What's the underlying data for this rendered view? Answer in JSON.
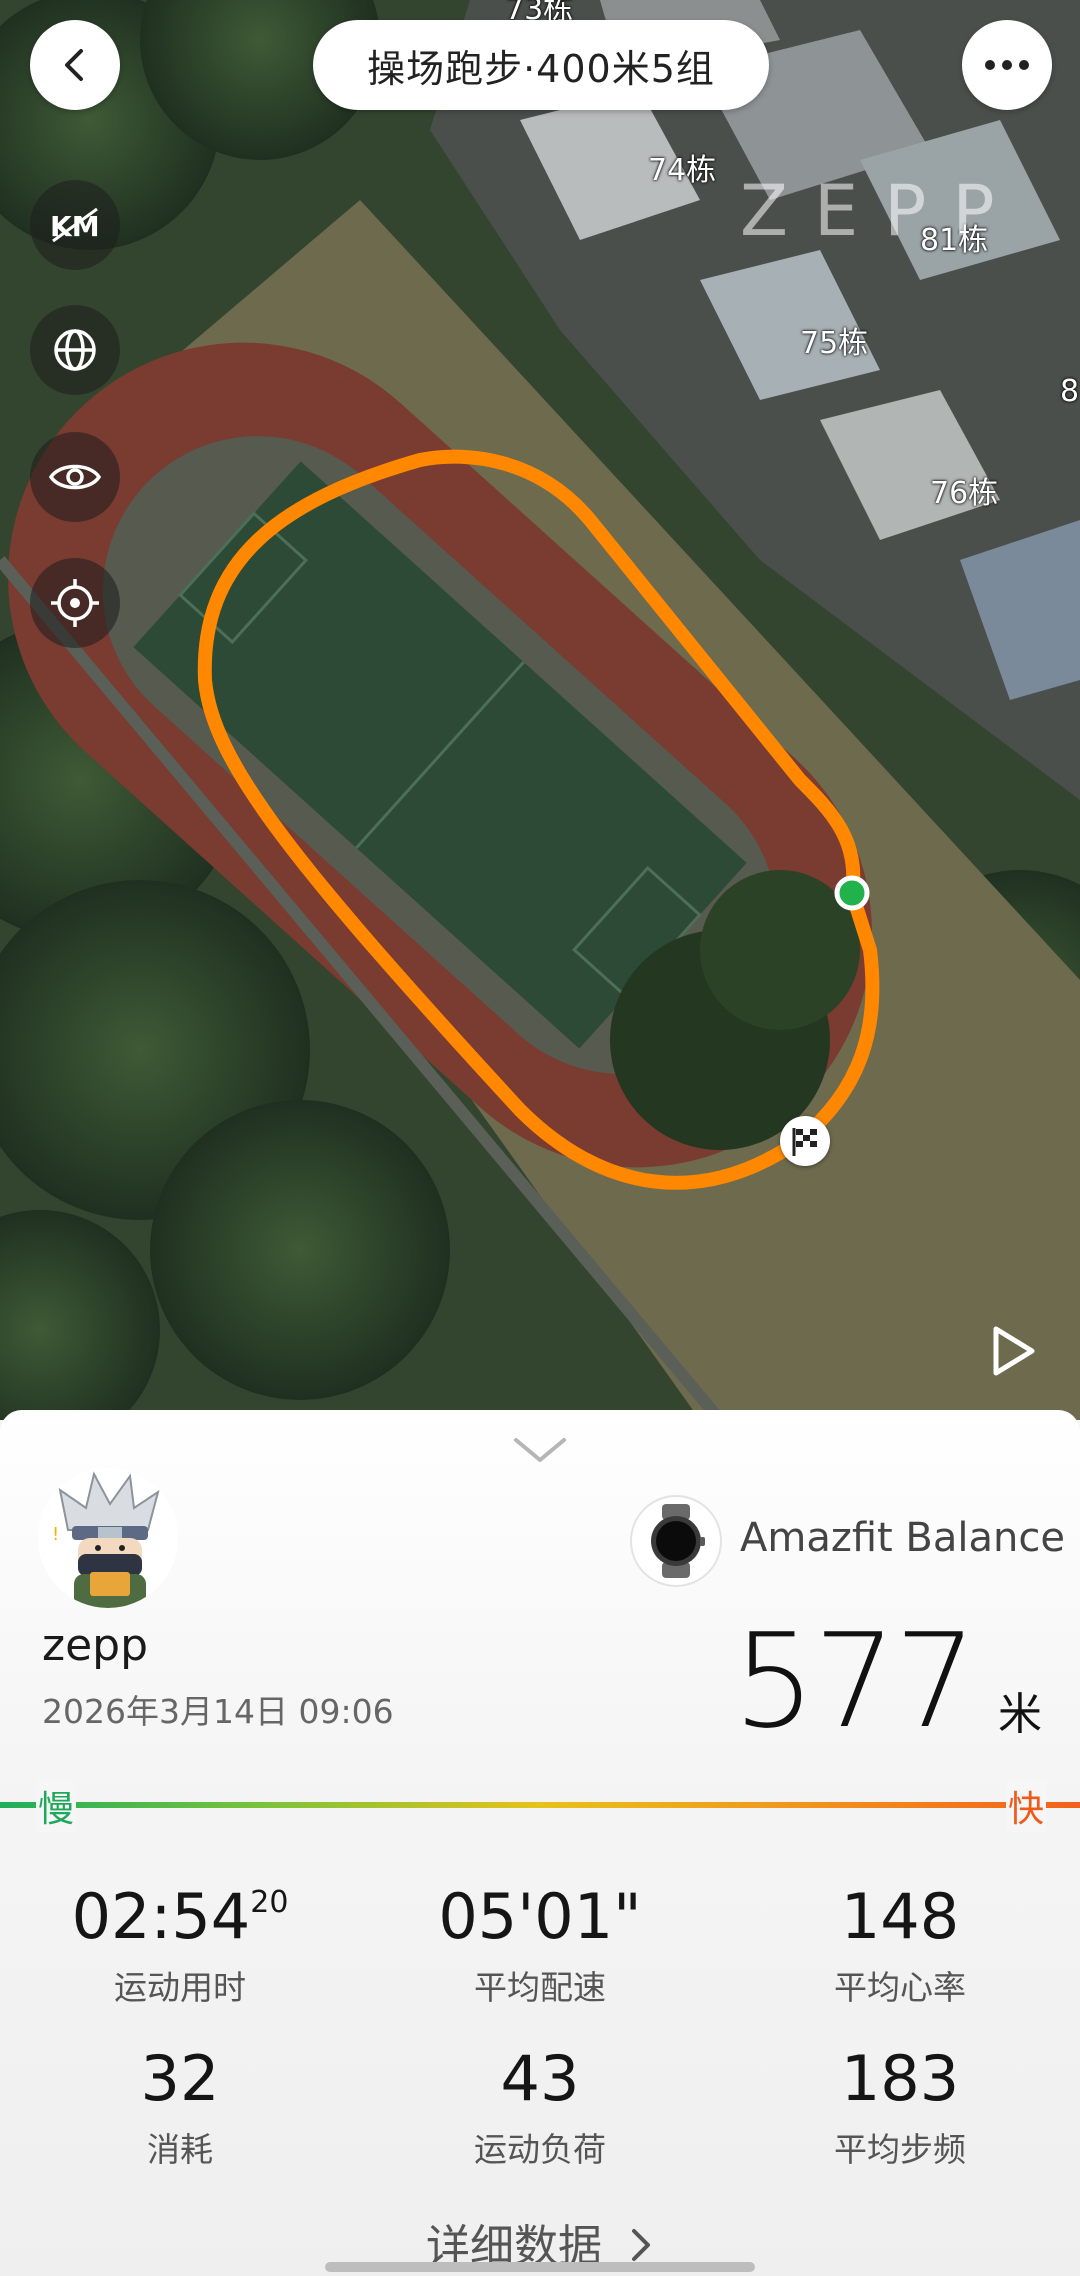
{
  "header": {
    "title": "操场跑步·400米5组"
  },
  "map": {
    "watermark": "ZEPP",
    "building_labels": [
      "73栋",
      "74栋",
      "81栋",
      "75栋",
      "76栋",
      "8"
    ],
    "route_color": "#ff8a00",
    "start_color": "#22b24c",
    "tools": [
      "km-marker-icon",
      "globe-icon",
      "eye-icon",
      "locate-icon"
    ]
  },
  "profile": {
    "username": "zepp",
    "datetime": "2026年3月14日 09:06"
  },
  "device": {
    "name": "Amazfit Balance"
  },
  "distance": {
    "value": "577",
    "unit": "米"
  },
  "pace_scale": {
    "slow": "慢",
    "fast": "快"
  },
  "stats": [
    {
      "value": "02:54",
      "sup": "20",
      "label": "运动用时"
    },
    {
      "value": "05'01\"",
      "sup": "",
      "label": "平均配速"
    },
    {
      "value": "148",
      "sup": "",
      "label": "平均心率"
    },
    {
      "value": "32",
      "sup": "",
      "label": "消耗"
    },
    {
      "value": "43",
      "sup": "",
      "label": "运动负荷"
    },
    {
      "value": "183",
      "sup": "",
      "label": "平均步频"
    }
  ],
  "detail_link": "详细数据"
}
